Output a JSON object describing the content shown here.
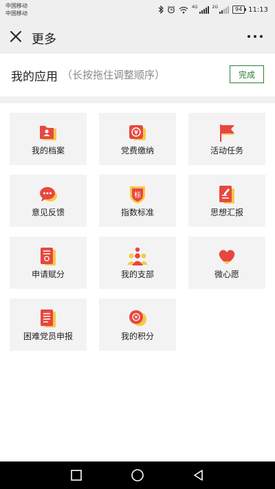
{
  "status_bar": {
    "carrier1": "中国移动",
    "carrier2": "中国移动",
    "net1": "4G",
    "net2": "2G",
    "battery": "94",
    "time": "11:13",
    "icons": [
      "bluetooth-icon",
      "alarm-icon",
      "wifi-icon",
      "signal-icon",
      "battery-icon"
    ]
  },
  "topbar": {
    "title": "更多",
    "close_icon": "close-icon",
    "more_icon": "more-dots-icon"
  },
  "section": {
    "title": "我的应用",
    "hint": "（长按拖住调整顺序）",
    "done_label": "完成"
  },
  "tiles": [
    {
      "label": "我的档案",
      "icon": "archive-folder-icon"
    },
    {
      "label": "党费缴纳",
      "icon": "party-fee-payment-icon"
    },
    {
      "label": "活动任务",
      "icon": "flag-icon"
    },
    {
      "label": "意见反馈",
      "icon": "chat-bubble-icon"
    },
    {
      "label": "指数标准",
      "icon": "standard-badge-icon"
    },
    {
      "label": "思想汇报",
      "icon": "edit-document-icon"
    },
    {
      "label": "申请赋分",
      "icon": "apply-score-document-icon"
    },
    {
      "label": "我的支部",
      "icon": "party-branch-group-icon"
    },
    {
      "label": "微心愿",
      "icon": "heart-icon"
    },
    {
      "label": "困难党员申报",
      "icon": "report-document-icon"
    },
    {
      "label": "我的积分",
      "icon": "points-coin-icon"
    }
  ],
  "colors": {
    "accent_red": "#e8473f",
    "accent_yellow": "#f7c948",
    "done_green": "#2e7d32"
  },
  "nav_bar": {
    "icons": [
      "recent-apps-square-icon",
      "home-circle-icon",
      "back-triangle-icon"
    ]
  }
}
